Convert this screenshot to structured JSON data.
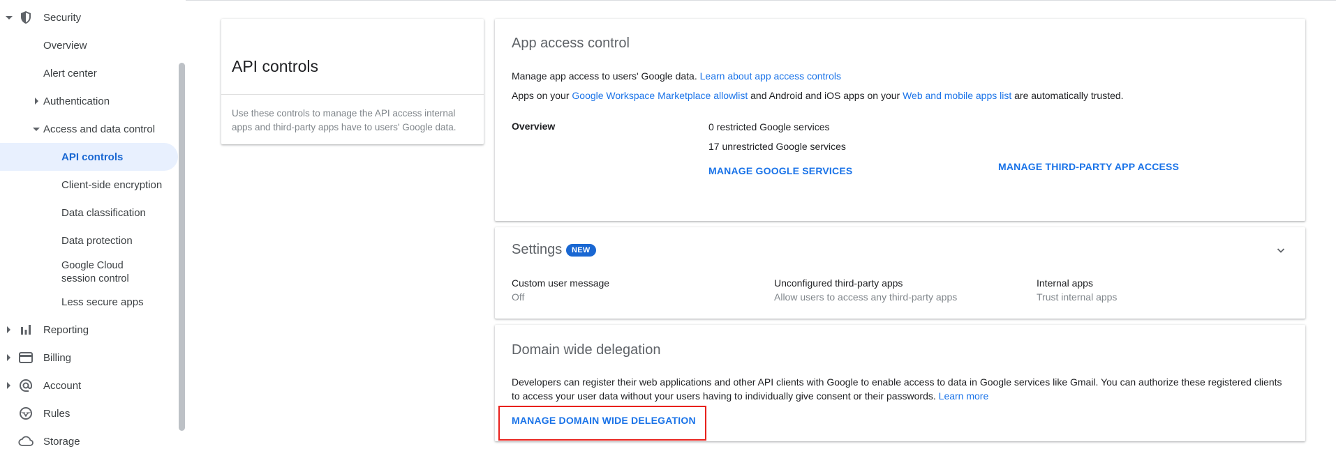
{
  "sidebar": {
    "items": [
      {
        "label": "Security",
        "icon": "shield-icon",
        "expanded": true
      },
      {
        "label": "Overview"
      },
      {
        "label": "Alert center"
      },
      {
        "label": "Authentication",
        "expanded": false
      },
      {
        "label": "Access and data control",
        "expanded": true
      },
      {
        "label": "API controls",
        "selected": true
      },
      {
        "label": "Client-side encryption"
      },
      {
        "label": "Data classification"
      },
      {
        "label": "Data protection"
      },
      {
        "label": "Google Cloud session control"
      },
      {
        "label": "Less secure apps"
      },
      {
        "label": "Reporting",
        "icon": "bar-chart-icon",
        "expanded": false
      },
      {
        "label": "Billing",
        "icon": "credit-card-icon",
        "expanded": false
      },
      {
        "label": "Account",
        "icon": "at-sign-icon",
        "expanded": false
      },
      {
        "label": "Rules",
        "icon": "steering-wheel-icon"
      },
      {
        "label": "Storage",
        "icon": "cloud-icon"
      }
    ]
  },
  "intro": {
    "title": "API controls",
    "description": "Use these controls to manage the API access internal apps and third-party apps have to users' Google data."
  },
  "access": {
    "title": "App access control",
    "line1_text": "Manage app access to users' Google data.",
    "line1_link": "Learn about app access controls",
    "line2_prefix": "Apps on your",
    "line2_link1": "Google Workspace Marketplace allowlist",
    "line2_mid": "and Android and iOS apps on your",
    "line2_link2": "Web and mobile apps list",
    "line2_suffix": "are automatically trusted.",
    "overview_label": "Overview",
    "restricted": "0 restricted Google services",
    "unrestricted": "17 unrestricted Google services",
    "manage_google_services": "MANAGE GOOGLE SERVICES",
    "manage_third_party": "MANAGE THIRD-PARTY APP ACCESS"
  },
  "settings": {
    "title": "Settings",
    "badge": "NEW",
    "items": [
      {
        "label": "Custom user message",
        "value": "Off"
      },
      {
        "label": "Unconfigured third-party apps",
        "value": "Allow users to access any third-party apps"
      },
      {
        "label": "Internal apps",
        "value": "Trust internal apps"
      }
    ]
  },
  "delegation": {
    "title": "Domain wide delegation",
    "description": "Developers can register their web applications and other API clients with Google to enable access to data in Google services like Gmail. You can authorize these registered clients to access your user data without your users having to individually give consent or their passwords.",
    "learn_more": "Learn more",
    "manage_button": "MANAGE DOMAIN WIDE DELEGATION"
  },
  "colors": {
    "accent": "#1a73e8",
    "selected_bg": "#e8f0fe",
    "badge_bg": "#1967d2",
    "highlight": "#e8211c"
  }
}
